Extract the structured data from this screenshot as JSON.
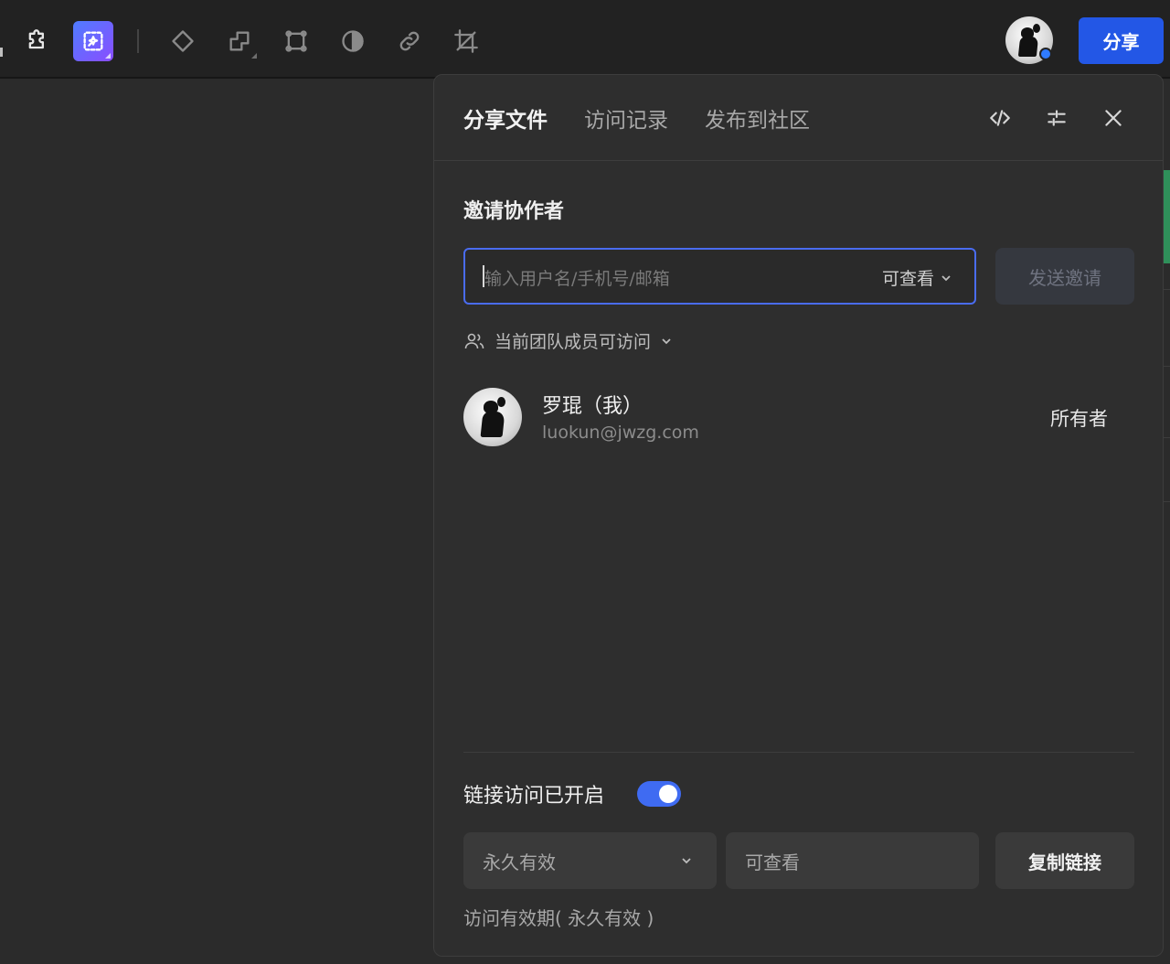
{
  "toolbar": {
    "tools": [
      "plugin-icon",
      "ai-image-icon",
      "component-icon",
      "boolean-icon",
      "frame-icon",
      "mask-icon",
      "link-icon",
      "crop-icon"
    ],
    "share_label": "分享",
    "accent_color": "#2357e6"
  },
  "panel": {
    "tabs": [
      {
        "label": "分享文件",
        "active": true
      },
      {
        "label": "访问记录",
        "active": false
      },
      {
        "label": "发布到社区",
        "active": false
      }
    ],
    "header_icons": [
      "code-icon",
      "settings-sliders-icon",
      "close-icon"
    ],
    "invite": {
      "title": "邀请协作者",
      "placeholder": "输入用户名/手机号/邮箱",
      "value": "",
      "permission": "可查看",
      "send_label": "发送邀请"
    },
    "team_access": "当前团队成员可访问",
    "members": [
      {
        "name": "罗琨（我）",
        "email": "luokun@jwzg.com",
        "role": "所有者"
      }
    ],
    "link": {
      "title": "链接访问已开启",
      "enabled": true,
      "toggle_color": "#3f6bf2",
      "expiry": "永久有效",
      "permission": "可查看",
      "copy_label": "复制链接",
      "validity_text": "访问有效期( 永久有效 )"
    }
  }
}
